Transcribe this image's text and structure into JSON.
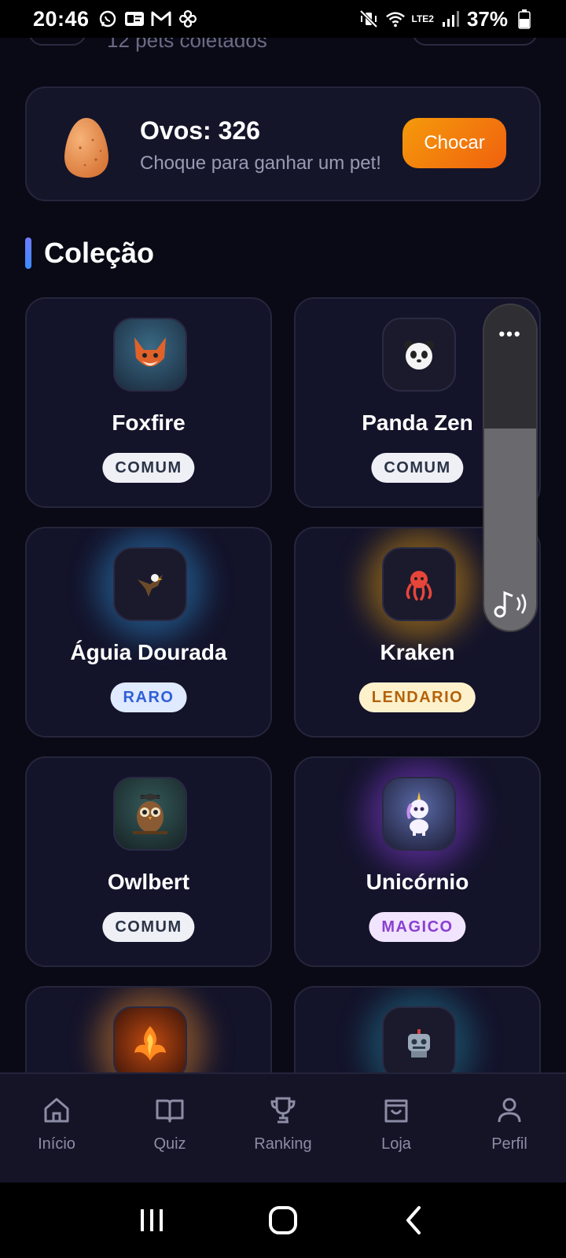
{
  "status_bar": {
    "time": "20:46",
    "battery": "37%",
    "network": "LTE2"
  },
  "header_partial": {
    "subtitle": "12 pets coletados"
  },
  "eggs": {
    "title": "Ovos: 326",
    "subtitle": "Choque para ganhar um pet!",
    "button": "Chocar"
  },
  "collection": {
    "title": "Coleção",
    "pets": [
      {
        "name": "Foxfire",
        "rarity": "COMUM",
        "icon": "fox-icon"
      },
      {
        "name": "Panda Zen",
        "rarity": "COMUM",
        "icon": "panda-icon"
      },
      {
        "name": "Águia Dourada",
        "rarity": "RARO",
        "icon": "eagle-icon"
      },
      {
        "name": "Kraken",
        "rarity": "LENDARIO",
        "icon": "octopus-icon"
      },
      {
        "name": "Owlbert",
        "rarity": "COMUM",
        "icon": "owl-icon"
      },
      {
        "name": "Unicórnio",
        "rarity": "MAGICO",
        "icon": "unicorn-icon"
      },
      {
        "name": "",
        "rarity": "",
        "icon": "phoenix-icon"
      },
      {
        "name": "",
        "rarity": "",
        "icon": "robot-icon"
      }
    ]
  },
  "volume_panel": {
    "dots": "•••",
    "level": 0.62
  },
  "nav": [
    {
      "label": "Início",
      "icon": "home-icon"
    },
    {
      "label": "Quiz",
      "icon": "book-icon"
    },
    {
      "label": "Ranking",
      "icon": "trophy-icon"
    },
    {
      "label": "Loja",
      "icon": "bag-icon"
    },
    {
      "label": "Perfil",
      "icon": "user-icon"
    }
  ],
  "colors": {
    "accent_orange": "#f0610e",
    "background": "#0a0a16",
    "card": "#13132a"
  }
}
